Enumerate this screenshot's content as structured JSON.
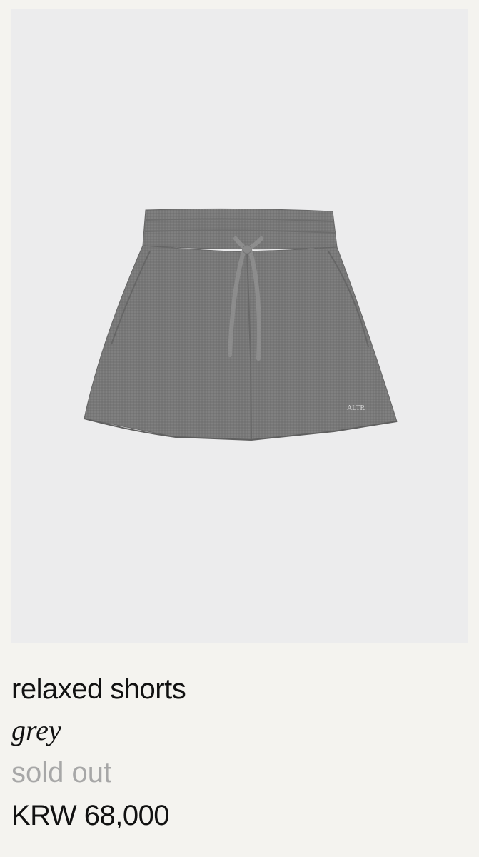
{
  "product": {
    "name": "relaxed shorts",
    "color": "grey",
    "status": "sold out",
    "price": "KRW 68,000",
    "image_icon": "grey-shorts-image"
  },
  "colors": {
    "background": "#f4f3ef",
    "photo_background": "#ececed",
    "text": "#111111",
    "muted_text": "#a7a7a7",
    "garment": "#7a7a7a"
  }
}
